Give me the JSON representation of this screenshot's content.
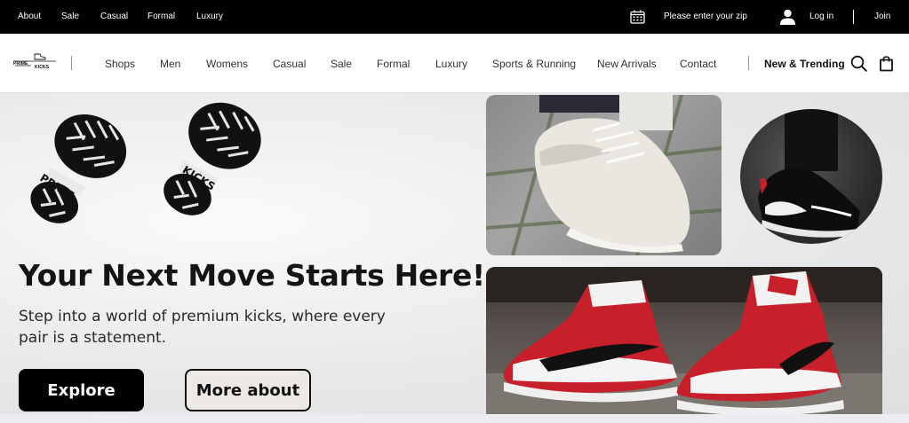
{
  "topbar": {
    "links": [
      "About",
      "Sale",
      "Casual",
      "Formal",
      "Luxury"
    ],
    "zip_prompt": "Please enter your zip",
    "login": "Log in",
    "join": "Join"
  },
  "logo": {
    "top": "PRIME",
    "bottom": "KICKS"
  },
  "nav": {
    "items": [
      "Shops",
      "Men",
      "Womens",
      "Casual",
      "Sale",
      "Formal",
      "Luxury",
      "Sports & Running",
      "New Arrivals",
      "Contact"
    ],
    "trending": "New & Trending"
  },
  "hero": {
    "footprint_left": "PRIME",
    "footprint_right": "KICKS",
    "headline": "Your Next Move Starts Here!",
    "subline": "Step into a world of premium kicks, where every pair is a statement.",
    "explore_label": "Explore",
    "more_label": "More about"
  },
  "icons": {
    "calendar": "calendar-icon",
    "user": "user-icon",
    "search": "search-icon",
    "bag": "shopping-bag-icon"
  },
  "colors": {
    "topbar": "#000000",
    "accent_red": "#c8202a",
    "text": "#111111"
  }
}
